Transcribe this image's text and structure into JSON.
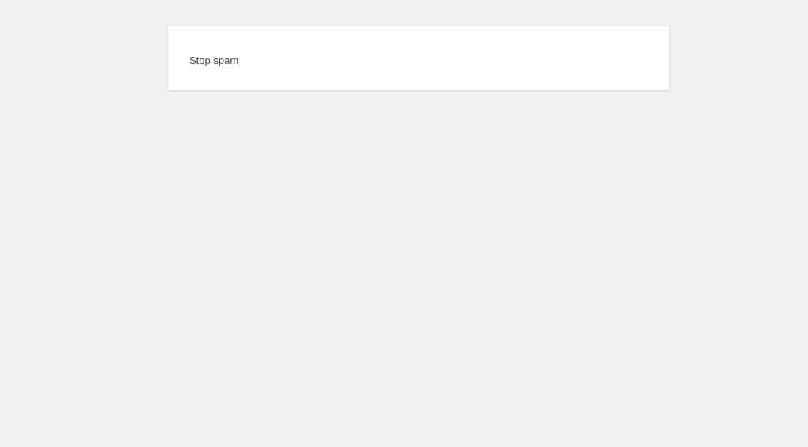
{
  "notice": {
    "message": "Stop spam"
  },
  "colors": {
    "background": "#f1f1f1",
    "card": "#ffffff",
    "text": "#444444"
  }
}
